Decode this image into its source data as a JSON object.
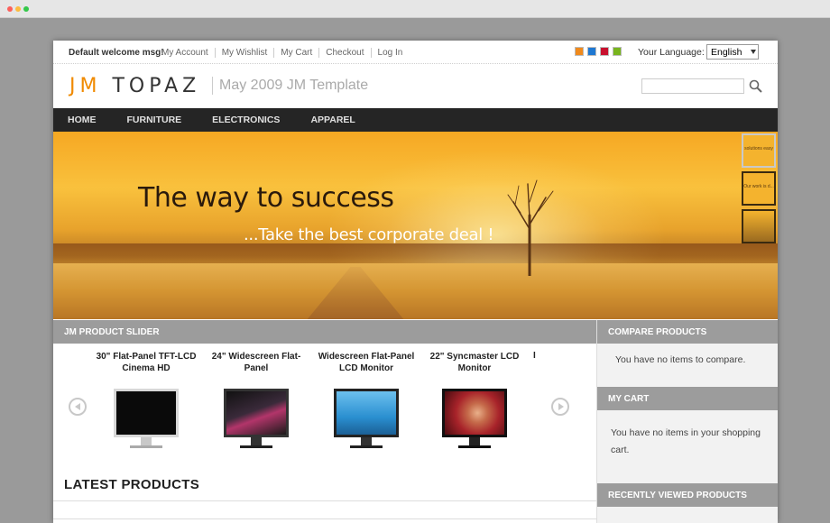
{
  "topbar": {
    "welcome": "Default welcome msg!",
    "links": [
      "My Account",
      "My Wishlist",
      "My Cart",
      "Checkout",
      "Log In"
    ],
    "swatch_colors": [
      "#f08a1c",
      "#1e78d2",
      "#c8102e",
      "#78b41e"
    ],
    "language_label": "Your Language:",
    "language_value": "English"
  },
  "header": {
    "logo_prefix": "JM",
    "logo_name": "TOPAZ",
    "tagline": "May 2009 JM Template",
    "search_placeholder": ""
  },
  "nav": {
    "items": [
      "HOME",
      "FURNITURE",
      "ELECTRONICS",
      "APPAREL"
    ]
  },
  "hero": {
    "title": "The way to success",
    "subtitle": "...Take the best corporate deal !",
    "thumbs": [
      "solutions easy",
      "Our work is d...",
      ""
    ]
  },
  "product_slider": {
    "title": "JM PRODUCT SLIDER",
    "products": [
      {
        "name": "30\" Flat-Panel TFT-LCD Cinema HD",
        "screen_color": "#0a0a0a"
      },
      {
        "name": "24\" Widescreen Flat-Panel",
        "screen_color": "#3a2a3a"
      },
      {
        "name": "Widescreen Flat-Panel LCD Monitor",
        "screen_color": "#2a8fd0"
      },
      {
        "name": "22\" Syncmaster LCD Monitor",
        "screen_color": "#a8232a"
      }
    ],
    "cut_product": "I"
  },
  "latest": {
    "title": "LATEST PRODUCTS"
  },
  "sidebar": {
    "compare_title": "COMPARE PRODUCTS",
    "compare_text": "You have no items to compare.",
    "cart_title": "MY CART",
    "cart_text": "You have no items in your shopping cart.",
    "recent_title": "RECENTLY VIEWED PRODUCTS"
  }
}
